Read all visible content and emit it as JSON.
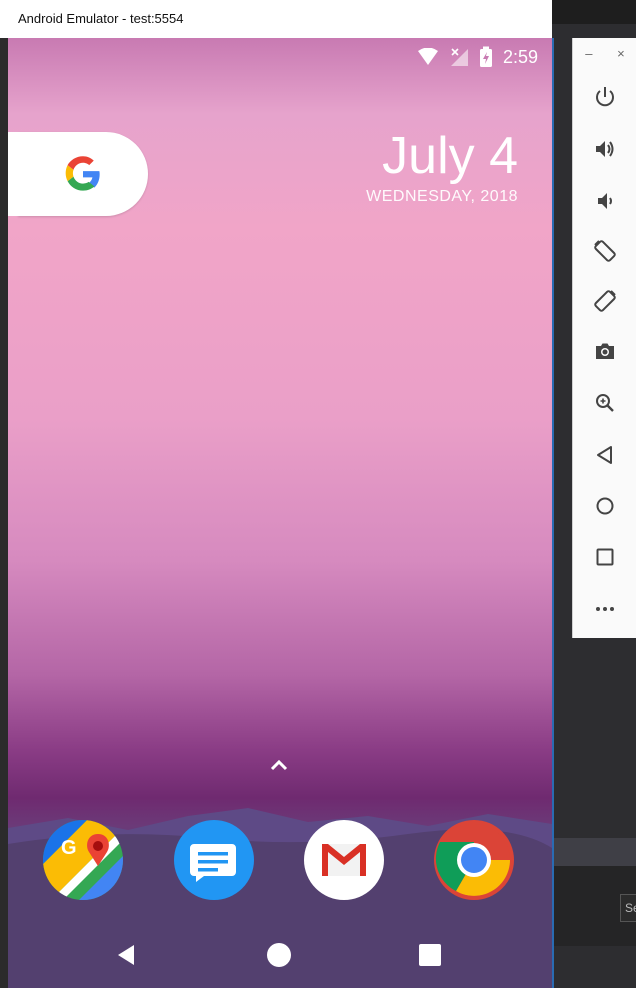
{
  "window": {
    "title": "Android Emulator - test:5554"
  },
  "status_bar": {
    "time": "2:59",
    "icons": [
      "wifi-icon",
      "no-signal-icon",
      "battery-charging-icon"
    ]
  },
  "home": {
    "search_widget": {
      "icon": "google-g-icon"
    },
    "date": {
      "day": "July 4",
      "weekday_line": "WEDNESDAY, 2018"
    },
    "drawer_handle_icon": "chevron-up-icon",
    "dock_apps": [
      {
        "name": "Maps",
        "icon": "google-maps-icon"
      },
      {
        "name": "Messages",
        "icon": "messages-icon"
      },
      {
        "name": "Gmail",
        "icon": "gmail-icon"
      },
      {
        "name": "Chrome",
        "icon": "chrome-icon"
      }
    ],
    "nav_buttons": [
      "back-icon",
      "home-icon",
      "recents-icon"
    ]
  },
  "toolbar": {
    "window_controls": {
      "minimize": "–",
      "close": "×"
    },
    "tools": [
      "power-icon",
      "volume-up-icon",
      "volume-down-icon",
      "rotate-left-icon",
      "rotate-right-icon",
      "camera-icon",
      "zoom-icon",
      "back-icon",
      "home-icon",
      "overview-icon",
      "more-icon"
    ]
  },
  "host": {
    "partial_label": "Se"
  },
  "colors": {
    "accent_blue": "#2a6bb3",
    "google_blue": "#4285F4",
    "google_red": "#EA4335",
    "google_yellow": "#FBBC05",
    "google_green": "#34A853"
  }
}
